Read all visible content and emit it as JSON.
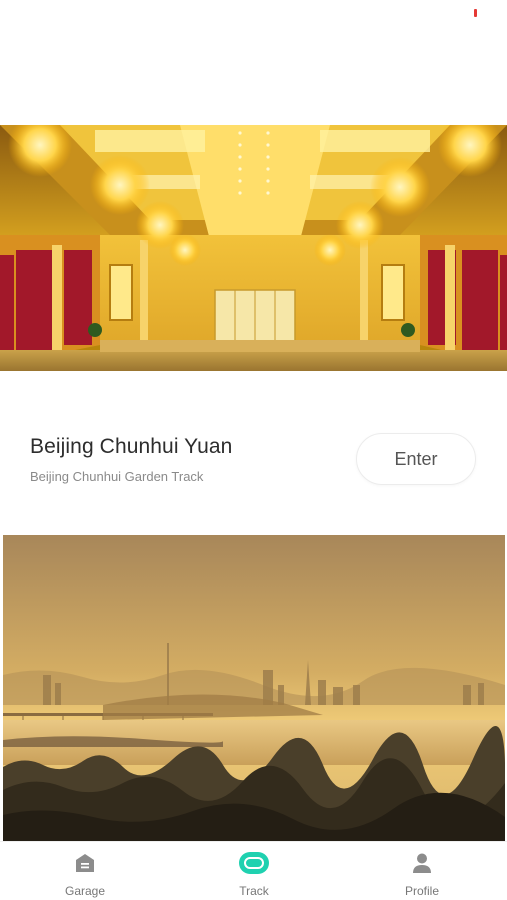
{
  "status_bar": {
    "battery_color": "#e53935"
  },
  "hero": {
    "image_description_icon": "banquet-hall-image"
  },
  "track": {
    "name": "Beijing Chunhui Yuan",
    "subtitle": "Beijing Chunhui Garden Track",
    "enter_label": "Enter"
  },
  "landscape": {
    "image_description_icon": "city-skyline-image"
  },
  "nav": {
    "items": [
      {
        "label": "Garage",
        "icon": "garage-icon",
        "active": false
      },
      {
        "label": "Track",
        "icon": "track-icon",
        "active": true
      },
      {
        "label": "Profile",
        "icon": "profile-icon",
        "active": false
      }
    ],
    "active_color": "#1fd1b0",
    "inactive_color": "#8c8c8c"
  }
}
